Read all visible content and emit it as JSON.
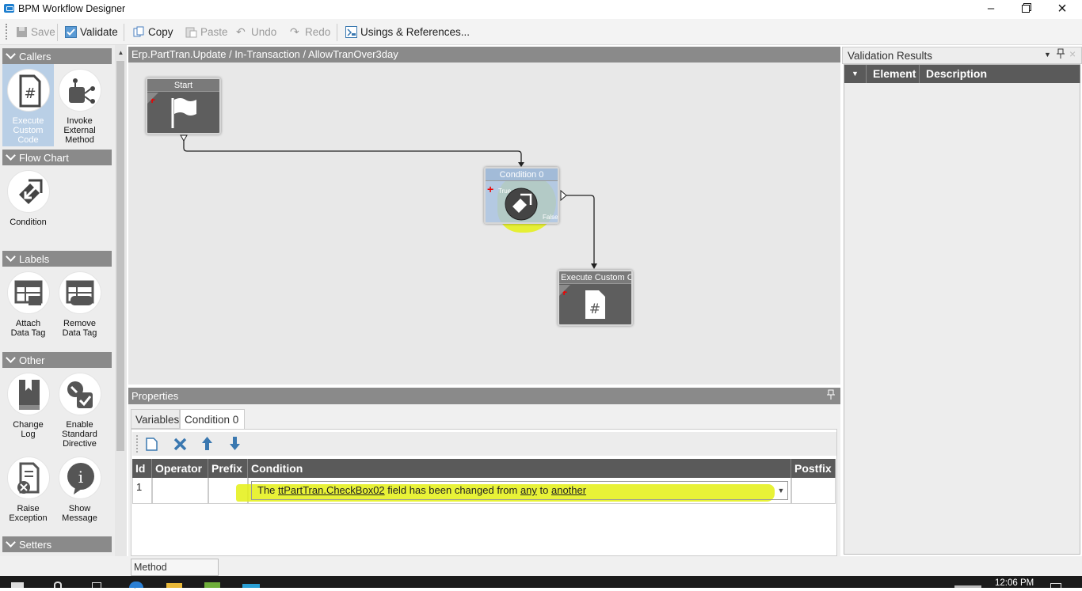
{
  "window": {
    "title": "BPM Workflow Designer",
    "minimize_icon": "minimize-icon",
    "restore_icon": "restore-icon",
    "close_icon": "close-icon"
  },
  "toolbar": {
    "save": "Save",
    "validate": "Validate",
    "copy": "Copy",
    "paste": "Paste",
    "undo": "Undo",
    "redo": "Redo",
    "usings": "Usings & References..."
  },
  "toolbox": {
    "groups": {
      "callers": "Callers",
      "flowchart": "Flow Chart",
      "labels": "Labels",
      "other": "Other",
      "setters": "Setters"
    },
    "tools": {
      "execute_custom_code": "Execute Custom Code",
      "invoke_external": "Invoke External Method",
      "condition": "Condition",
      "attach_data_tag": "Attach Data Tag",
      "remove_data_tag": "Remove Data Tag",
      "change_log": "Change Log",
      "enable_standard_directive": "Enable Standard Directive",
      "raise_exception": "Raise Exception",
      "show_message": "Show Message"
    }
  },
  "canvas": {
    "breadcrumb": "Erp.PartTran.Update / In-Transaction / AllowTranOver3day",
    "nodes": {
      "start": "Start",
      "condition": "Condition 0",
      "condition_true": "True",
      "condition_false": "False",
      "execute": "Execute Custom Co"
    }
  },
  "properties": {
    "title": "Properties",
    "tabs": [
      "Variables",
      "Condition 0"
    ],
    "active_tab": "Condition 0",
    "columns": [
      "Id",
      "Operator",
      "Prefix",
      "Condition",
      "Postfix"
    ],
    "row": {
      "id": "1",
      "operator": "",
      "prefix": "",
      "cond_pre": "The ",
      "cond_field": "ttPartTran.CheckBox02",
      "cond_mid": " field has been changed from ",
      "cond_from": "any",
      "cond_to_word": " to ",
      "cond_to": "another",
      "postfix": ""
    }
  },
  "validation": {
    "title": "Validation Results",
    "columns": [
      "Element",
      "Description"
    ]
  },
  "bottom": {
    "method_parameters": "Method parameters"
  },
  "taskbar": {
    "time": "12:06 PM"
  },
  "colors": {
    "accent": "#1e7fcf",
    "header_gray": "#8a8a8a",
    "node_dark": "#5e5e5e",
    "highlight": "#e4f014",
    "selected_tool": "#b9cfe6"
  }
}
